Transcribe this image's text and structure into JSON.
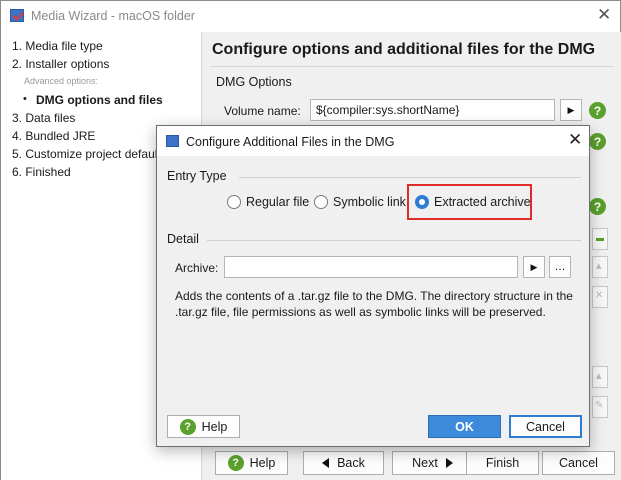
{
  "window": {
    "title": "Media Wizard - macOS folder"
  },
  "sidebar": {
    "steps": [
      {
        "label": "1. Media file type"
      },
      {
        "label": "2. Installer options"
      },
      {
        "label": "Advanced options:"
      },
      {
        "label": "DMG options and files"
      },
      {
        "label": "3. Data files"
      },
      {
        "label": "4. Bundled JRE"
      },
      {
        "label": "5. Customize project defaults"
      },
      {
        "label": "6. Finished"
      }
    ]
  },
  "main": {
    "title": "Configure options and additional files for the DMG",
    "section": "DMG Options",
    "volume_label": "Volume name:",
    "volume_value": "${compiler:sys.shortName}"
  },
  "bottom": {
    "help": "Help",
    "back": "Back",
    "next": "Next",
    "finish": "Finish",
    "cancel": "Cancel"
  },
  "dialog": {
    "title": "Configure Additional Files in the DMG",
    "entry_type": "Entry Type",
    "radios": {
      "regular": "Regular file",
      "symlink": "Symbolic link",
      "extracted": "Extracted archive"
    },
    "selected": "Extracted archive",
    "detail": "Detail",
    "archive_label": "Archive:",
    "archive_value": "",
    "description": "Adds the contents of a .tar.gz file to the DMG. The directory structure in the .tar.gz file, file permissions as well as symbolic links will be preserved.",
    "help": "Help",
    "ok": "OK",
    "cancel": "Cancel"
  },
  "colors": {
    "accent": "#2f7dd3",
    "help_green": "#5aa02c",
    "highlight_red": "#e02b2b"
  }
}
